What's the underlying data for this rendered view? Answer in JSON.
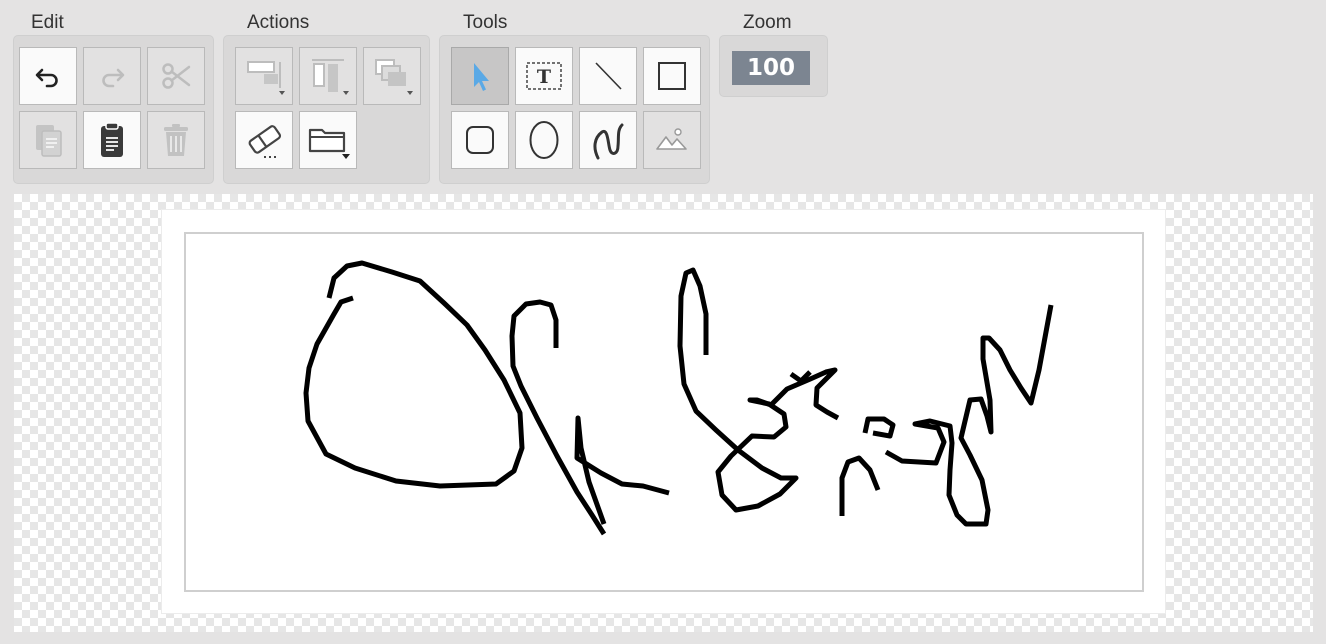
{
  "toolbar": {
    "groups": {
      "edit": "Edit",
      "actions": "Actions",
      "tools": "Tools",
      "zoom": "Zoom"
    },
    "zoom_value": "100"
  },
  "colors": {
    "accent": "#5aa9e6",
    "zoom_badge": "#7c8591",
    "toolbar_bg": "#e4e3e3",
    "selected_tool_bg": "#c7c6c6",
    "ink": "#000000"
  },
  "icons": {
    "edit": [
      "undo-icon",
      "redo-icon",
      "cut-icon",
      "copy-icon",
      "paste-icon",
      "delete-icon"
    ],
    "actions": [
      "align-horizontal-icon",
      "align-vertical-icon",
      "arrange-icon",
      "eraser-icon",
      "open-folder-icon"
    ],
    "tools": [
      "select-pointer-icon",
      "text-icon",
      "line-icon",
      "rectangle-icon",
      "rounded-rectangle-icon",
      "ellipse-icon",
      "freehand-icon",
      "image-icon"
    ]
  },
  "selected_tool": "select-pointer"
}
